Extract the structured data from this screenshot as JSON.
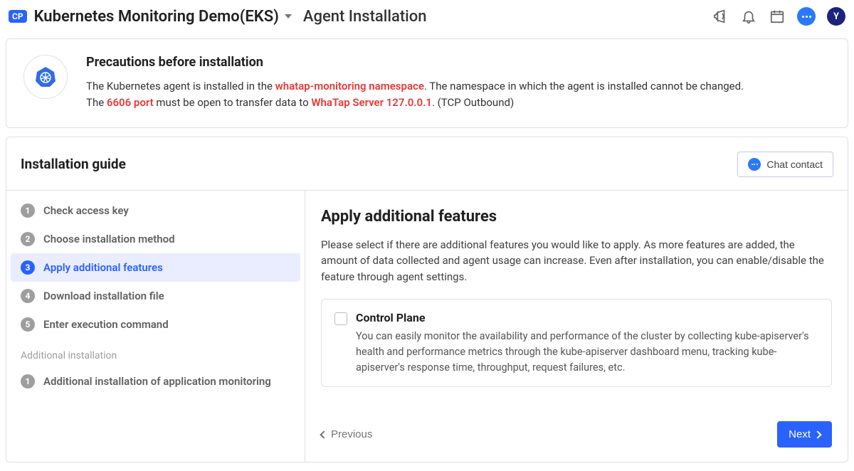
{
  "topbar": {
    "cp_badge": "CP",
    "project_name": "Kubernetes Monitoring Demo(EKS)",
    "page_title": "Agent Installation",
    "avatar_letter": "Y"
  },
  "precaution": {
    "title": "Precautions before installation",
    "line1_a": "The Kubernetes agent is installed in the ",
    "line1_hl": "whatap-monitoring namespace",
    "line1_b": ". The namespace in which the agent is installed cannot be changed.",
    "line2_a": "The ",
    "line2_hl1": "6606 port",
    "line2_b": " must be open to transfer data to ",
    "line2_hl2": "WhaTap Server 127.0.0.1",
    "line2_c": ". (TCP Outbound)"
  },
  "guide": {
    "title": "Installation guide",
    "chat_contact": "Chat contact",
    "steps": [
      {
        "num": "1",
        "label": "Check access key"
      },
      {
        "num": "2",
        "label": "Choose installation method"
      },
      {
        "num": "3",
        "label": "Apply additional features"
      },
      {
        "num": "4",
        "label": "Download installation file"
      },
      {
        "num": "5",
        "label": "Enter execution command"
      }
    ],
    "additional_label": "Additional installation",
    "additional_step": {
      "num": "1",
      "label": "Additional installation of application monitoring"
    }
  },
  "main": {
    "heading": "Apply additional features",
    "description": "Please select if there are additional features you would like to apply. As more features are added, the amount of data collected and agent usage can increase. Even after installation, you can enable/disable the feature through agent settings.",
    "feature": {
      "title": "Control Plane",
      "desc": "You can easily monitor the availability and performance of the cluster by collecting kube-apiserver's health and performance metrics through the kube-apiserver dashboard menu, tracking kube-apiserver's response time, throughput, request failures, etc."
    },
    "prev_label": "Previous",
    "next_label": "Next"
  }
}
